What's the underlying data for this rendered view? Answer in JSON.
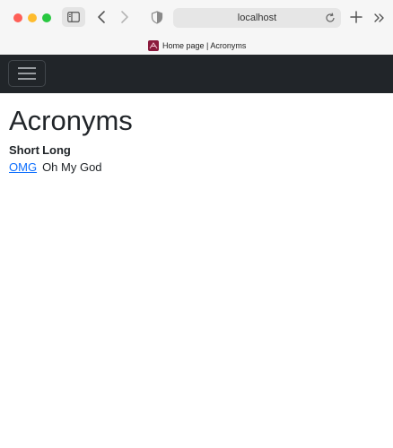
{
  "browser": {
    "url": "localhost",
    "tab_title": "Home page | Acronyms",
    "colors": {
      "close": "#fe5f57",
      "minimize": "#febc2e",
      "zoom": "#28c840"
    }
  },
  "navbar": {
    "background": "#212529",
    "toggler_icon": "hamburger-icon"
  },
  "page": {
    "title": "Acronyms",
    "table": {
      "headers": {
        "short": "Short",
        "long": "Long"
      },
      "rows": [
        {
          "short": "OMG",
          "long": "Oh My God"
        }
      ]
    },
    "link_color": "#0d6efd"
  }
}
